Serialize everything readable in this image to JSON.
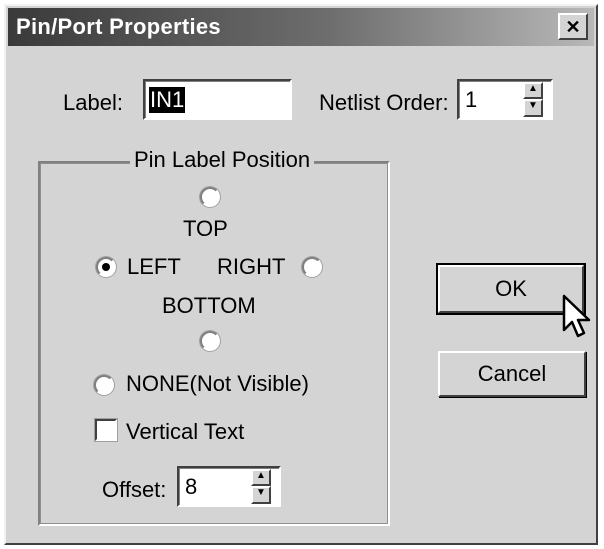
{
  "dialog": {
    "title": "Pin/Port Properties",
    "close_glyph": "✕"
  },
  "label_field": {
    "label": "Label:",
    "value": "IN1"
  },
  "netlist_order": {
    "label": "Netlist Order:",
    "value": "1"
  },
  "pin_label_position": {
    "group_title": "Pin Label Position",
    "top": "TOP",
    "left": "LEFT",
    "right": "RIGHT",
    "bottom": "BOTTOM",
    "none": "NONE(Not Visible)",
    "selected": "LEFT"
  },
  "vertical_text": {
    "label": "Vertical Text",
    "checked": false
  },
  "offset": {
    "label": "Offset:",
    "value": "8"
  },
  "buttons": {
    "ok": "OK",
    "cancel": "Cancel"
  }
}
